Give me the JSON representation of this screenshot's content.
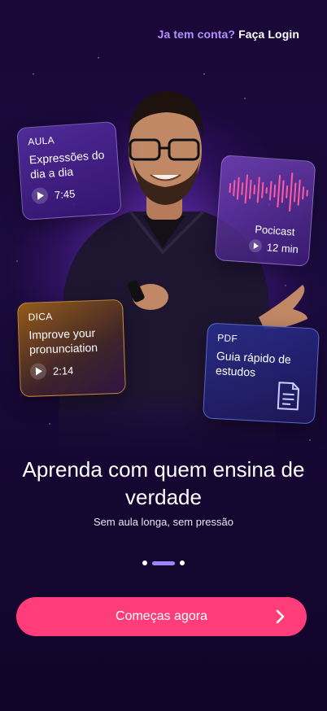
{
  "header": {
    "login_question": "Ja tem conta?",
    "login_action": "Faça Login"
  },
  "cards": {
    "aula": {
      "tag": "AULA",
      "title": "Expressões do dia a dia",
      "duration": "7:45"
    },
    "podcast": {
      "title": "Pocicast",
      "duration": "12 min"
    },
    "dica": {
      "tag": "DICA",
      "title": "Improve your pronunciation",
      "duration": "2:14"
    },
    "pdf": {
      "tag": "PDF",
      "title": "Guia rápido de estudos"
    }
  },
  "hero": {
    "headline": "Aprenda com quem ensina de verdade",
    "subtitle": "Sem aula longa, sem pressão"
  },
  "pagination": {
    "total": 3,
    "active": 2
  },
  "cta": {
    "label": "Começas agora"
  },
  "colors": {
    "accent": "#ff3d7a",
    "link": "#b590ff",
    "background": "#12052b",
    "dot_active": "#9c85ff"
  },
  "icons": [
    "play-icon",
    "document-icon",
    "chevron-right-icon",
    "waveform-icon"
  ]
}
